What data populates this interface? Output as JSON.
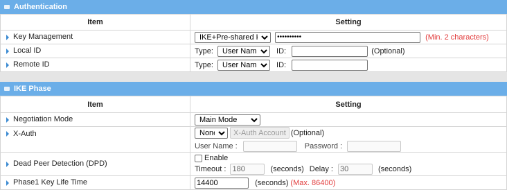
{
  "auth": {
    "title": "Authentication",
    "col_item": "Item",
    "col_setting": "Setting",
    "key_mgmt": {
      "label": "Key Management",
      "select_value": "IKE+Pre-shared Key",
      "password_value": "••••••••••",
      "hint": "(Min. 2 characters)"
    },
    "local_id": {
      "label": "Local ID",
      "type_label": "Type:",
      "type_value": "User Name",
      "id_label": "ID:",
      "id_value": "",
      "optional": "(Optional)"
    },
    "remote_id": {
      "label": "Remote ID",
      "type_label": "Type:",
      "type_value": "User Name",
      "id_label": "ID:",
      "id_value": ""
    }
  },
  "ike": {
    "title": "IKE Phase",
    "col_item": "Item",
    "col_setting": "Setting",
    "negotiation": {
      "label": "Negotiation Mode",
      "value": "Main Mode"
    },
    "xauth": {
      "label": "X-Auth",
      "value": "None",
      "account_button": "X-Auth Account",
      "optional": "(Optional)",
      "username_label": "User Name :",
      "username_value": "",
      "password_label": "Password :",
      "password_value": ""
    },
    "dpd": {
      "label": "Dead Peer Detection (DPD)",
      "enable_label": "Enable",
      "enabled": false,
      "timeout_label": "Timeout :",
      "timeout_value": "180",
      "seconds1": "(seconds)",
      "delay_label": "Delay :",
      "delay_value": "30",
      "seconds2": "(seconds)"
    },
    "phase1": {
      "label": "Phase1 Key Life Time",
      "value": "14400",
      "seconds": "(seconds)",
      "max": "(Max. 86400)"
    }
  },
  "colors": {
    "header_bg": "#6baee8",
    "arrow": "#3b8ad2",
    "warning": "#e23b3b"
  }
}
